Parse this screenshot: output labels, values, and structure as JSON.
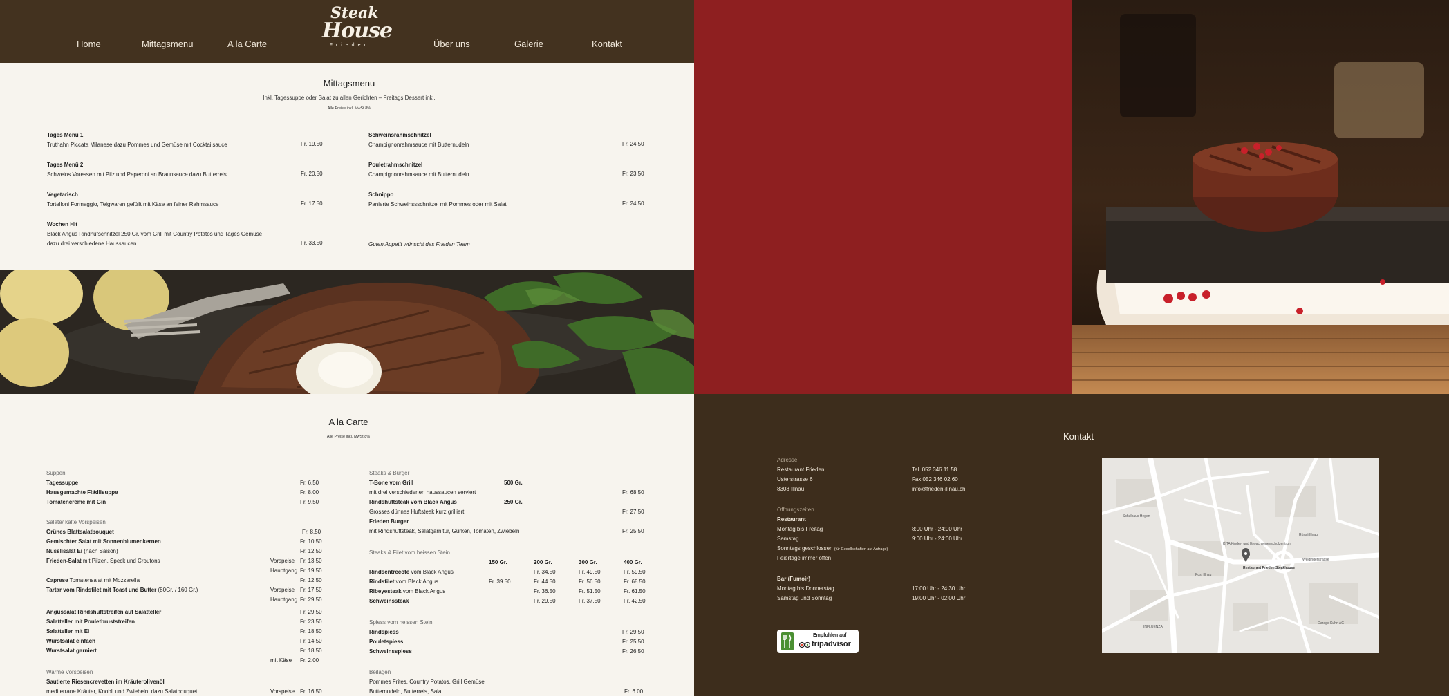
{
  "header": {
    "nav_left": [
      "Home",
      "Mittagsmenu",
      "A la Carte"
    ],
    "nav_right": [
      "Über uns",
      "Galerie",
      "Kontakt"
    ],
    "logo": {
      "line1": "Steak",
      "line2": "House",
      "line3": "Frieden"
    }
  },
  "colors": {
    "header_bg": "#43321f",
    "red_panel": "#8e1f20",
    "cream": "#f7f4ee",
    "dark_brown": "#3d2d1c"
  },
  "mittag": {
    "title": "Mittagsmenu",
    "subtitle": "Inkl. Tagessuppe oder Salat zu allen Gerichten – Freitags Dessert inkl.",
    "vat": "Alle Preise inkl. MwSt 8%",
    "left": [
      {
        "name": "Tages Menü 1",
        "desc": "Truthahn Piccata Milanese dazu Pommes und Gemüse mit Cocktailsauce",
        "desc2": "",
        "price": "Fr. 19.50"
      },
      {
        "name": "Tages Menü 2",
        "desc": "Schweins Voressen mit Pilz und Peperoni an Braunsauce dazu Butterreis",
        "desc2": "",
        "price": "Fr.  20.50"
      },
      {
        "name": "Vegetarisch",
        "desc": "Tortelloni Formaggio, Teigwaren gefüllt mit Käse an feiner Rahmsauce",
        "desc2": "",
        "price": "Fr.  17.50"
      },
      {
        "name": "Wochen Hit",
        "desc": "Black Angus Rindhufschnitzel 250 Gr. vom Grill mit Country Potatos und Tages Gemüse",
        "desc2": "dazu drei verschiedene Haussaucen",
        "price": "Fr.  33.50"
      }
    ],
    "right": [
      {
        "name": "Schweinsrahmschnitzel",
        "desc": "Champignonrahmsauce mit Butternudeln",
        "price": "Fr. 24.50"
      },
      {
        "name": "Pouletrahmschnitzel",
        "desc": "Champignonrahmsauce mit Butternudeln",
        "price": "Fr.  23.50"
      },
      {
        "name": "Schnippo",
        "desc": "Panierte Schweinssschnitzel mit Pommes oder mit Salat",
        "price": "Fr.  24.50"
      }
    ],
    "closing": "Guten Appetit wünscht das Frieden Team"
  },
  "carte": {
    "title": "A la Carte",
    "vat": "Alle Preise inkl. MwSt 8%",
    "left": [
      {
        "cat": "Suppen"
      },
      {
        "name": "Tagessuppe",
        "price": "Fr.  6.50"
      },
      {
        "name": "Hausgemachte Flädlisuppe",
        "price": "Fr.  8.00"
      },
      {
        "name": "Tomatencrème mit Gin",
        "price": "Fr.  9.50"
      },
      {
        "cat": "Salate/ kalte Vorspeisen"
      },
      {
        "name": "Grünes Blattsalatbouquet",
        "price": "Fr. 8.50"
      },
      {
        "name": "Gemischter Salat mit Sonnenblumenkernen",
        "price": "Fr. 10.50"
      },
      {
        "name": "Nüsslisalat Ei",
        "extra": "(nach Saison)",
        "price": "Fr. 12.50"
      },
      {
        "name": "Frieden-Salat",
        "extra": " mit Pilzen, Speck und Croutons",
        "portion": "Vorspeise",
        "price": "Fr. 13.50"
      },
      {
        "portion": "Hauptgang",
        "price": "Fr. 19.50"
      },
      {
        "name": "Caprese",
        "extra": "  Tomatensalat mit Mozzarella",
        "price": "Fr. 12.50"
      },
      {
        "name": "Tartar vom Rindsfilet mit Toast und Butter",
        "extra": " (80Gr. / 160 Gr.)",
        "portion": "Vorspeise",
        "price": "Fr. 17.50"
      },
      {
        "portion": "Hauptgang",
        "price": "Fr. 29.50"
      },
      {
        "name": "Angussalat Rindshuftstreifen auf Salatteller",
        "price": "Fr. 29.50"
      },
      {
        "name": "Salatteller mit Pouletbruststreifen",
        "price": "Fr. 23.50"
      },
      {
        "name": "Salatteller mit Ei",
        "price": "Fr. 18.50"
      },
      {
        "name": "Wurstsalat einfach",
        "price": "Fr. 14.50"
      },
      {
        "name": "Wurstsalat garniert",
        "price": "Fr. 18.50"
      },
      {
        "portion": "mit Käse",
        "price": "Fr.  2.00"
      },
      {
        "cat": "Warme Vorspeisen"
      },
      {
        "name": "Sautierte Riesencrevetten im Kräuterolivenöl"
      },
      {
        "desc": "mediterrane Kräuter, Knobli und Zwiebeln, dazu Salatbouquet",
        "portion": "Vorspeise",
        "price": "Fr. 16.50"
      }
    ],
    "steaks_cat": "Steaks & Burger",
    "steaks": [
      {
        "name": "T-Bone vom Grill",
        "weight": "500 Gr."
      },
      {
        "desc": "mit drei verschiedenen haussaucen serviert",
        "price": "Fr. 68.50"
      },
      {
        "name": "Rindshuftsteak vom Black Angus",
        "weight": "250 Gr."
      },
      {
        "desc": "Grosses dünnes Huftsteak kurz grilliert",
        "price": "Fr. 27.50"
      },
      {
        "name": "Frieden Burger"
      },
      {
        "desc": "mit Rindshuftsteak, Salatgarnitur, Gurken, Tomaten, Zwiebeln",
        "price": "Fr. 25.50"
      }
    ],
    "stone_cat": "Steaks & Filet vom heissen Stein",
    "stone_headers": [
      "150 Gr.",
      "200 Gr.",
      "300 Gr.",
      "400 Gr."
    ],
    "stone": [
      {
        "name": "",
        "prices": [
          "",
          "Fr. 34.50",
          "Fr. 49.50",
          "Fr. 59.50"
        ]
      },
      {
        "name": "Rindsentrecote",
        "extra": " vom Black Angus",
        "prices": [
          "",
          "",
          "",
          ""
        ]
      },
      {
        "name": "Rindsfilet",
        "extra": " vom Black Angus",
        "prices": [
          "Fr. 39.50",
          "Fr. 44.50",
          "Fr. 56.50",
          "Fr. 68.50"
        ]
      },
      {
        "name": "Ribeyesteak",
        "extra": " vom Black Angus",
        "prices": [
          "",
          "Fr. 36.50",
          "Fr. 51.50",
          "Fr. 61.50"
        ]
      },
      {
        "name": "Schweinssteak",
        "extra": "",
        "prices": [
          "",
          "Fr. 29.50",
          "Fr. 37.50",
          "Fr. 42.50"
        ]
      }
    ],
    "spiess_cat": "Spiess vom heissen Stein",
    "spiess": [
      {
        "name": "Rindspiess",
        "price": "Fr. 29.50"
      },
      {
        "name": "Pouletspiess",
        "price": "Fr. 25.50"
      },
      {
        "name": "Schweinsspiess",
        "price": "Fr. 26.50"
      }
    ],
    "beilagen_cat": "Beilagen",
    "beilagen": [
      {
        "desc": "Pommes Frites, Country Potatos, Grill Gemüse",
        "price": ""
      },
      {
        "desc": "Butternudeln, Butterreis, Salat",
        "price": "Fr. 6.00"
      }
    ]
  },
  "kontakt": {
    "title": "Kontakt",
    "adresse_label": "Adresse",
    "address": [
      "Restaurant Frieden",
      "Usterstrasse 6",
      "8308 Illnau"
    ],
    "contact": [
      "Tel. 052 346 11 58",
      "Fax 052 346 02 60",
      "info@frieden-illnau.ch"
    ],
    "hours_label": "Öffnungszeiten",
    "restaurant_label": "Restaurant",
    "restaurant_hours": [
      {
        "day": "Montag bis Freitag",
        "time": "8:00 Uhr - 24:00 Uhr"
      },
      {
        "day": "Samstag",
        "time": "9:00 Uhr - 24:00 Uhr"
      }
    ],
    "closed": "Sonntags geschlossen",
    "closed_note": "(für Gesellschaften auf Anfrage)",
    "holidays": "Feiertage immer offen",
    "bar_label": "Bar (Fumoir)",
    "bar_hours": [
      {
        "day": "Montag bis Donnerstag",
        "time": "17:00 Uhr - 24:30 Uhr"
      },
      {
        "day": "Samstag und Sonntag",
        "time": "19:00 Uhr - 02:00 Uhr"
      }
    ],
    "tripadvisor": {
      "line1": "Empfohlen auf",
      "line2": "tripadvisor"
    },
    "map_labels": {
      "restaurant": "Restaurant Frieden Steakhouse",
      "street": "Weidingerstrasse",
      "school": "Schulhaus Hegen",
      "kita": "KITA Kinder- und Erwachsenenschulzentrum",
      "post": "Post Illnau",
      "hotel": "Rössli Illnau",
      "inf": "INFLUENZA",
      "garage": "Garage Kuhn AG"
    }
  }
}
